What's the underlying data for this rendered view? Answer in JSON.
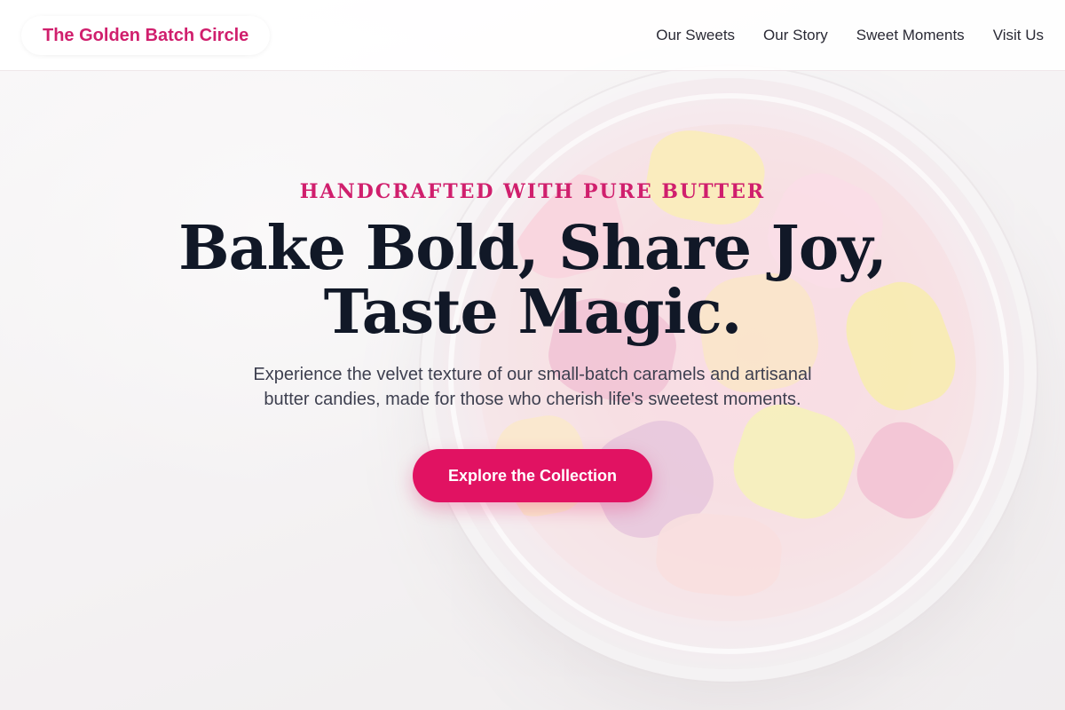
{
  "header": {
    "brand": "The Golden Batch Circle",
    "nav": [
      "Our Sweets",
      "Our Story",
      "Sweet Moments",
      "Visit Us"
    ]
  },
  "hero": {
    "eyebrow": "HANDCRAFTED WITH PURE BUTTER",
    "headline_line1": "Bake Bold, Share Joy,",
    "headline_line2": "Taste Magic.",
    "subtext": "Experience the velvet texture of our small-batch caramels and artisanal butter candies, made for those who cherish life's sweetest moments.",
    "cta_label": "Explore the Collection",
    "background_image": "candy-jar-photo"
  },
  "colors": {
    "brand": "#d01f6d",
    "cta": "#e11262",
    "headline": "#111827",
    "body_text": "#3d3f4f"
  }
}
